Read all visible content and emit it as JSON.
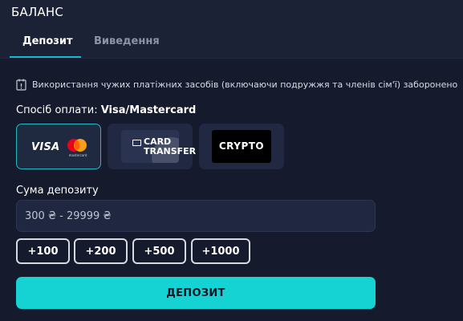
{
  "header": {
    "title": "БАЛАНС",
    "tabs": [
      {
        "label": "Депозит",
        "active": true
      },
      {
        "label": "Виведення",
        "active": false
      }
    ]
  },
  "warning": {
    "icon": "info-icon",
    "text": "Використання чужих платіжних засобів (включаючи подружжя та членів сім'ї) заборонено"
  },
  "payment": {
    "label": "Спосіб оплати:",
    "selected": "Visa/Mastercard",
    "methods": [
      {
        "name": "Visa/Mastercard",
        "visa_text": "VISA",
        "mc_sub": "mastercard",
        "selected": true
      },
      {
        "name": "Card transfer",
        "text": "CARD\nTRANSFER",
        "selected": false
      },
      {
        "name": "Crypto",
        "text": "CRYPTO",
        "selected": false
      }
    ]
  },
  "deposit": {
    "label": "Сума депозиту",
    "placeholder": "300 ₴ - 29999 ₴",
    "value": "",
    "quick_amounts": [
      "+100",
      "+200",
      "+500",
      "+1000"
    ],
    "submit_label": "ДЕПОЗИТ"
  },
  "colors": {
    "accent": "#15d3d3",
    "background": "#151a2c",
    "header": "#1c2236"
  }
}
